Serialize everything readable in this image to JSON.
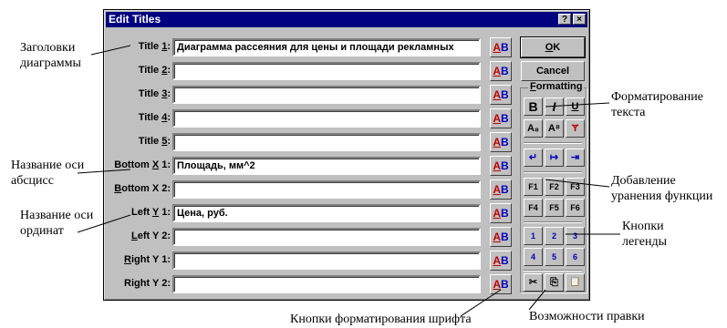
{
  "dialog": {
    "title": "Edit Titles",
    "help_btn": "?",
    "close_btn": "×",
    "rows": [
      {
        "pre": "Title ",
        "key": "1",
        "post": ":",
        "value": "Диаграмма рассеяния для цены и площади рекламных"
      },
      {
        "pre": "Title ",
        "key": "2",
        "post": ":",
        "value": ""
      },
      {
        "pre": "Title ",
        "key": "3",
        "post": ":",
        "value": ""
      },
      {
        "pre": "Title ",
        "key": "4",
        "post": ":",
        "value": ""
      },
      {
        "pre": "Title ",
        "key": "5",
        "post": ":",
        "value": ""
      },
      {
        "pre": "Bottom ",
        "key": "X",
        "post": " 1:",
        "value": "Площадь, мм^2"
      },
      {
        "pre": "",
        "key": "B",
        "post": "ottom X 2:",
        "value": ""
      },
      {
        "pre": "Left ",
        "key": "Y",
        "post": " 1:",
        "value": "Цена, руб."
      },
      {
        "pre": "",
        "key": "L",
        "post": "eft Y 2:",
        "value": ""
      },
      {
        "pre": "",
        "key": "R",
        "post": "ight Y 1:",
        "value": ""
      },
      {
        "pre": "Ri",
        "key": "g",
        "post": "ht Y 2:",
        "value": ""
      }
    ],
    "font_btn": {
      "a": "A",
      "b": "B"
    },
    "ok_pre": "",
    "ok_key": "O",
    "ok_post": "K",
    "cancel": "Cancel",
    "formatting": {
      "pre": "",
      "key": "F",
      "post": "ormatting"
    },
    "fmt_buttons": [
      "B",
      "I",
      "U"
    ],
    "script_buttons": [
      "A₈",
      "A⁸",
      "Ɏ"
    ],
    "line_buttons": [
      "↵",
      "↦",
      "⇥"
    ],
    "func_buttons": [
      "F1",
      "F2",
      "F3",
      "F4",
      "F5",
      "F6"
    ],
    "legend_buttons": [
      "1",
      "2",
      "3",
      "4",
      "5",
      "6"
    ],
    "edit_buttons": [
      "✂",
      "⎘",
      "📋"
    ]
  },
  "callouts": {
    "chart_titles": [
      "Заголовки",
      "диаграммы"
    ],
    "x_axis": [
      "Название оси",
      "абсцисс"
    ],
    "y_axis": [
      "Название оси",
      "ординат"
    ],
    "text_format": [
      "Форматирование",
      "текста"
    ],
    "func_eq": [
      "Добавление",
      "уранения функции"
    ],
    "legend": [
      "Кнопки",
      "легенды"
    ],
    "font_buttons": "Кнопки форматирования шрифта",
    "edit": "Возможности правки"
  }
}
